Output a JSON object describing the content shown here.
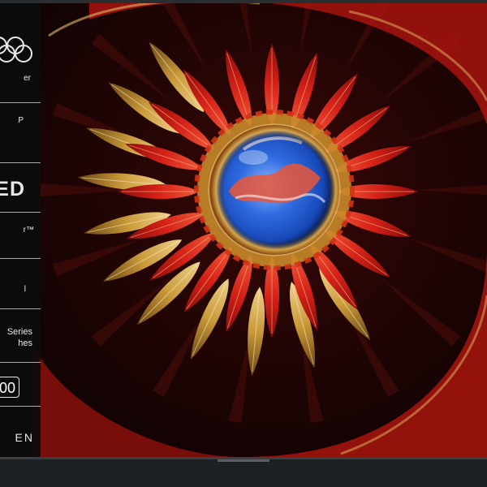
{
  "sidebar": {
    "line1": "er",
    "line2": "P",
    "big": "ED",
    "line3": "r™",
    "line4": "l",
    "series_line1": "Series",
    "series_line2": "hes",
    "value_box_text": "00",
    "bottom_word": "EN"
  },
  "artwork": {
    "icon": "spiral-petals-with-glass-orb",
    "colors": {
      "red": "#d52219",
      "gold": "#c99a3a",
      "dark": "#1a0303",
      "orb_blue": "#1848b8"
    }
  }
}
